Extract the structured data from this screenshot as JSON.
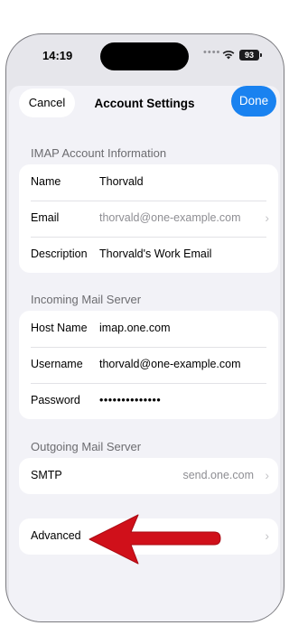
{
  "status": {
    "time": "14:19",
    "battery": "93"
  },
  "nav": {
    "cancel": "Cancel",
    "title": "Account Settings",
    "done": "Done"
  },
  "imap": {
    "header": "IMAP Account Information",
    "name_label": "Name",
    "name_value": "Thorvald",
    "email_label": "Email",
    "email_value": "thorvald@one-example.com",
    "description_label": "Description",
    "description_value": "Thorvald's Work Email"
  },
  "incoming": {
    "header": "Incoming Mail Server",
    "host_label": "Host Name",
    "host_value": "imap.one.com",
    "username_label": "Username",
    "username_value": "thorvald@one-example.com",
    "password_label": "Password",
    "password_value": "••••••••••••••"
  },
  "outgoing": {
    "header": "Outgoing Mail Server",
    "smtp_label": "SMTP",
    "smtp_value": "send.one.com"
  },
  "advanced": {
    "label": "Advanced"
  },
  "colors": {
    "accent": "#1982f0",
    "annotation_arrow": "#d0101a"
  },
  "icons": [
    "wifi-icon",
    "battery-icon",
    "chevron-right-icon",
    "annotation-arrow-icon"
  ]
}
